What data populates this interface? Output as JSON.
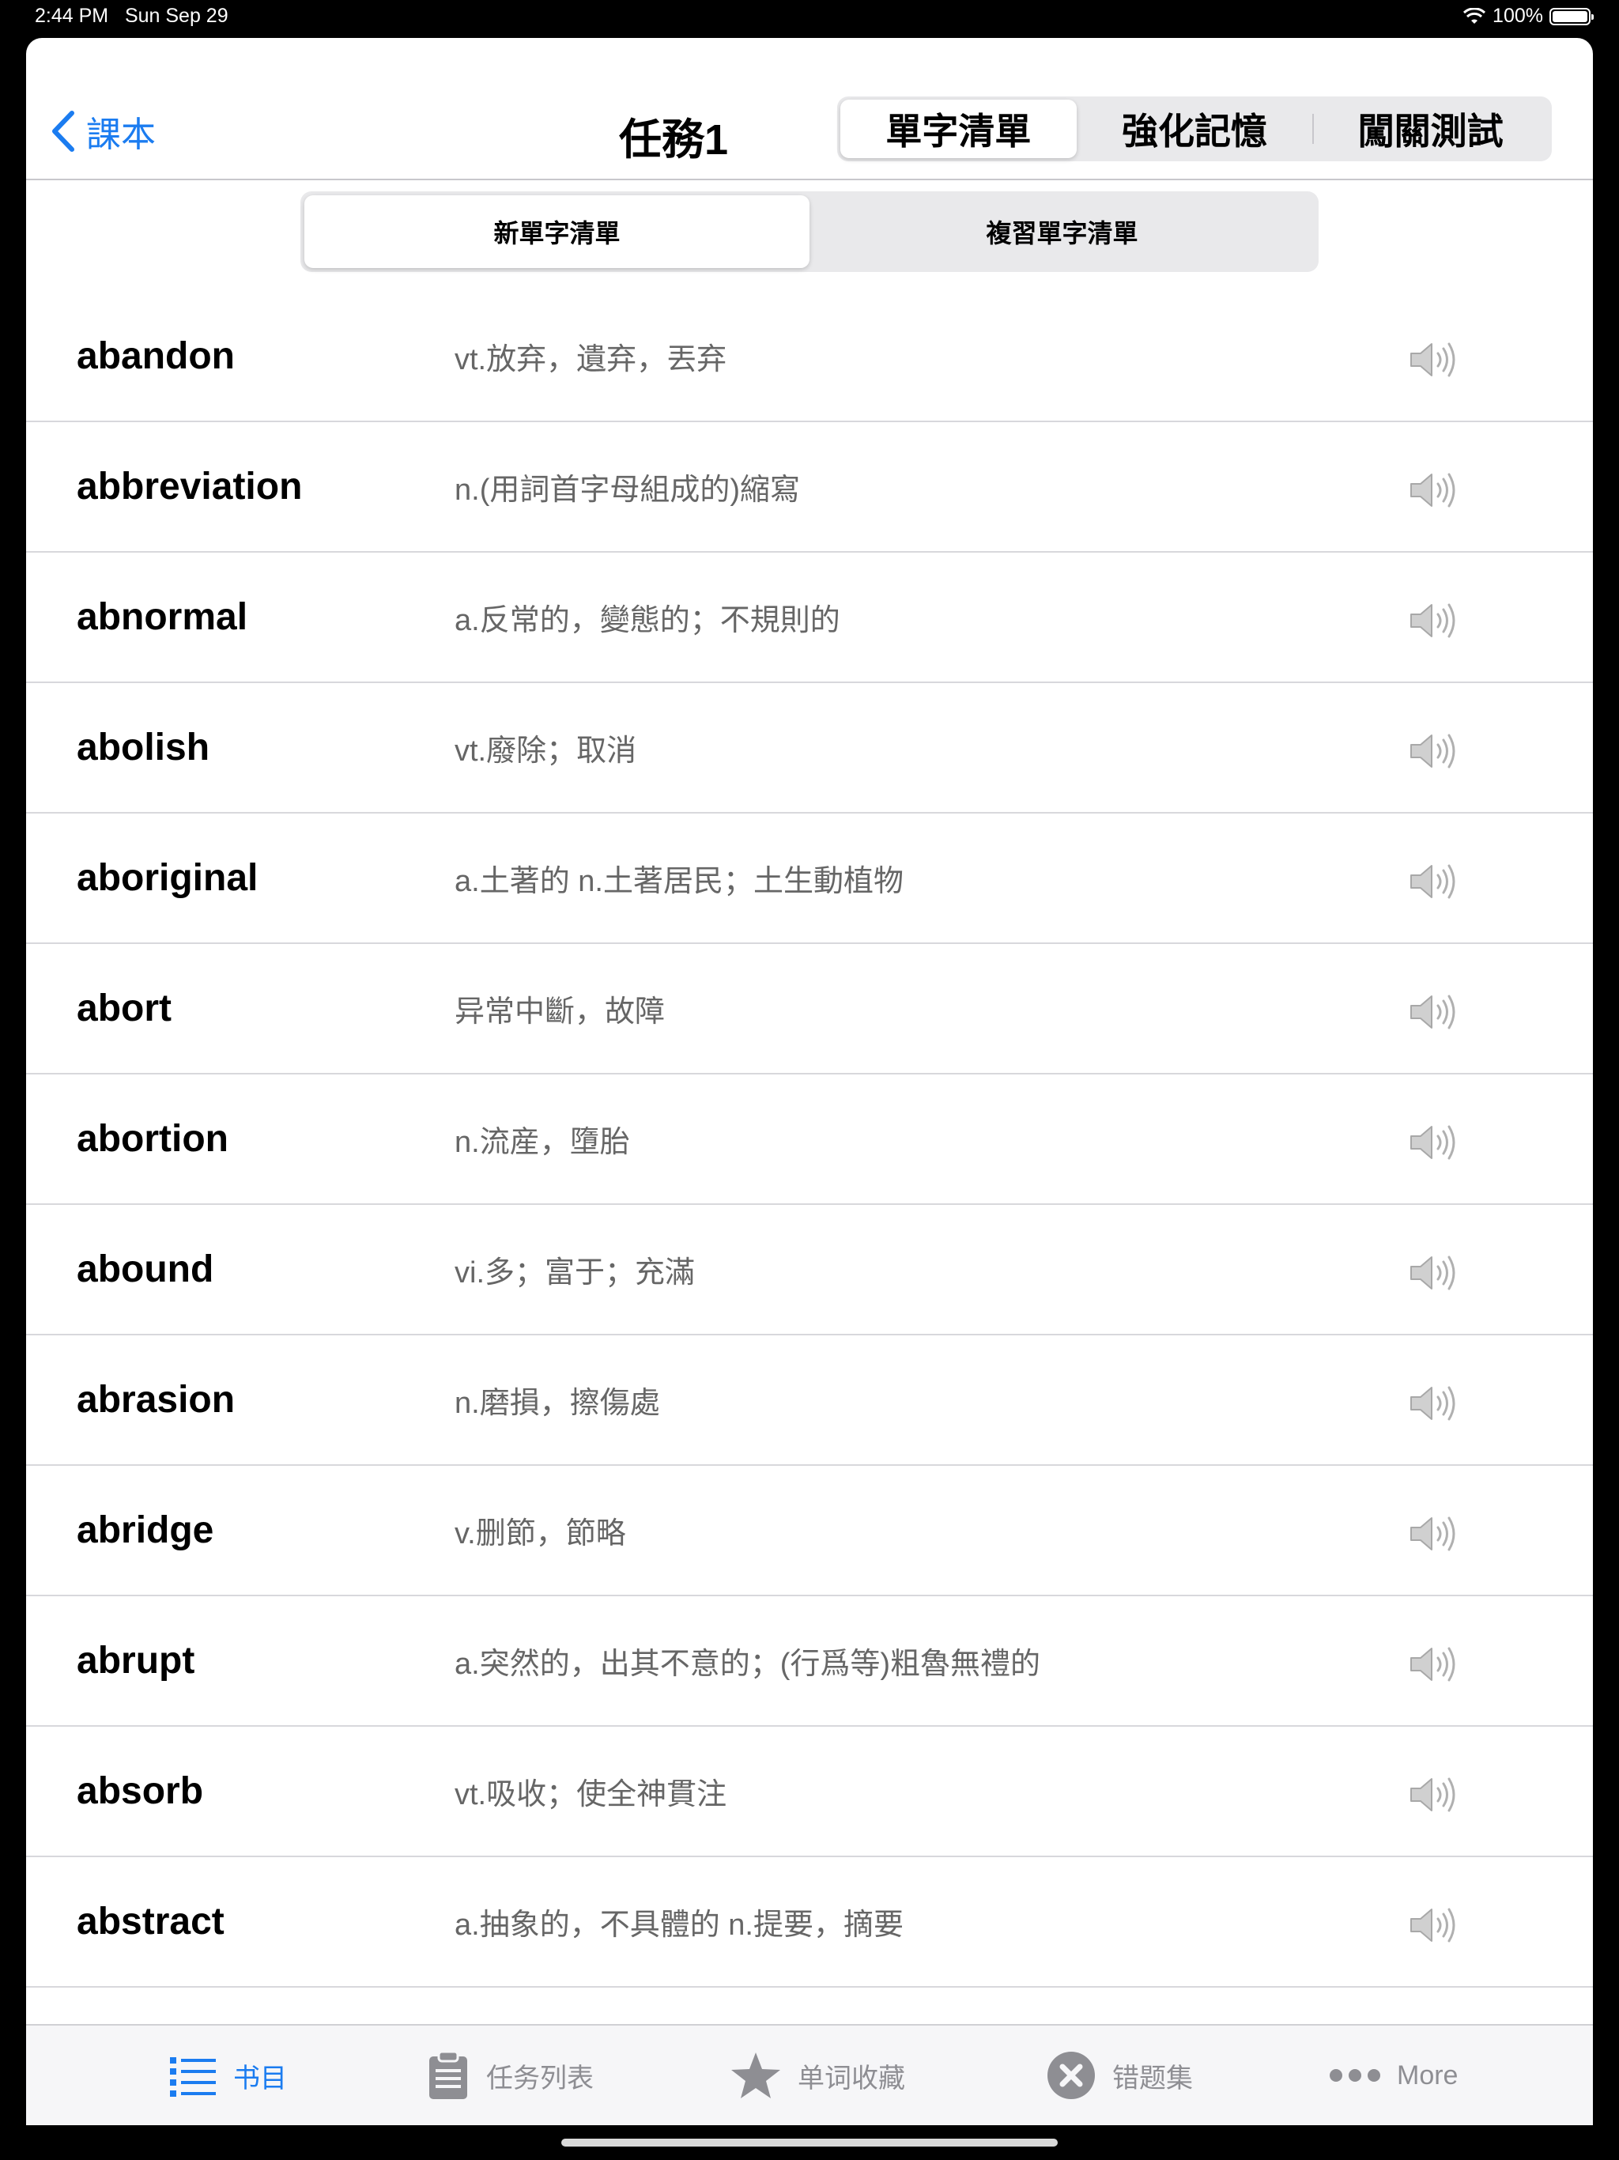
{
  "status_bar": {
    "time": "2:44 PM",
    "date": "Sun Sep 29",
    "battery": "100%",
    "battery_level": 1.0
  },
  "nav": {
    "back_label": "課本",
    "title": "任務1",
    "segments": [
      "單字清單",
      "強化記憶",
      "闖關測試"
    ],
    "selected_segment": 0
  },
  "sub_tabs": {
    "items": [
      "新單字清單",
      "複習單字清單"
    ],
    "selected": 0
  },
  "words": [
    {
      "word": "abandon",
      "definition": "vt.放弃，遺弃，丟弃"
    },
    {
      "word": "abbreviation",
      "definition": "n.(用詞首字母組成的)縮寫"
    },
    {
      "word": "abnormal",
      "definition": "a.反常的，變態的；不規則的"
    },
    {
      "word": "abolish",
      "definition": "vt.廢除；取消"
    },
    {
      "word": "aboriginal",
      "definition": "a.土著的 n.土著居民；土生動植物"
    },
    {
      "word": "abort",
      "definition": "异常中斷，故障"
    },
    {
      "word": "abortion",
      "definition": "n.流産，墮胎"
    },
    {
      "word": "abound",
      "definition": "vi.多；富于；充滿"
    },
    {
      "word": "abrasion",
      "definition": "n.磨損，擦傷處"
    },
    {
      "word": "abridge",
      "definition": "v.删節，節略"
    },
    {
      "word": "abrupt",
      "definition": "a.突然的，出其不意的；(行爲等)粗魯無禮的"
    },
    {
      "word": "absorb",
      "definition": "vt.吸收；使全神貫注"
    },
    {
      "word": "abstract",
      "definition": "a.抽象的，不具體的 n.提要，摘要"
    }
  ],
  "tab_bar": {
    "items": [
      {
        "label": "书目",
        "icon": "list-icon",
        "active": true
      },
      {
        "label": "任务列表",
        "icon": "clipboard-icon",
        "active": false
      },
      {
        "label": "单词收藏",
        "icon": "star-icon",
        "active": false
      },
      {
        "label": "错题集",
        "icon": "x-circle-icon",
        "active": false
      },
      {
        "label": "More",
        "icon": "more-dots-icon",
        "active": false
      }
    ]
  },
  "colors": {
    "accent": "#1b7cf0",
    "inactive": "#8e8e93",
    "definition_text": "#666666"
  }
}
